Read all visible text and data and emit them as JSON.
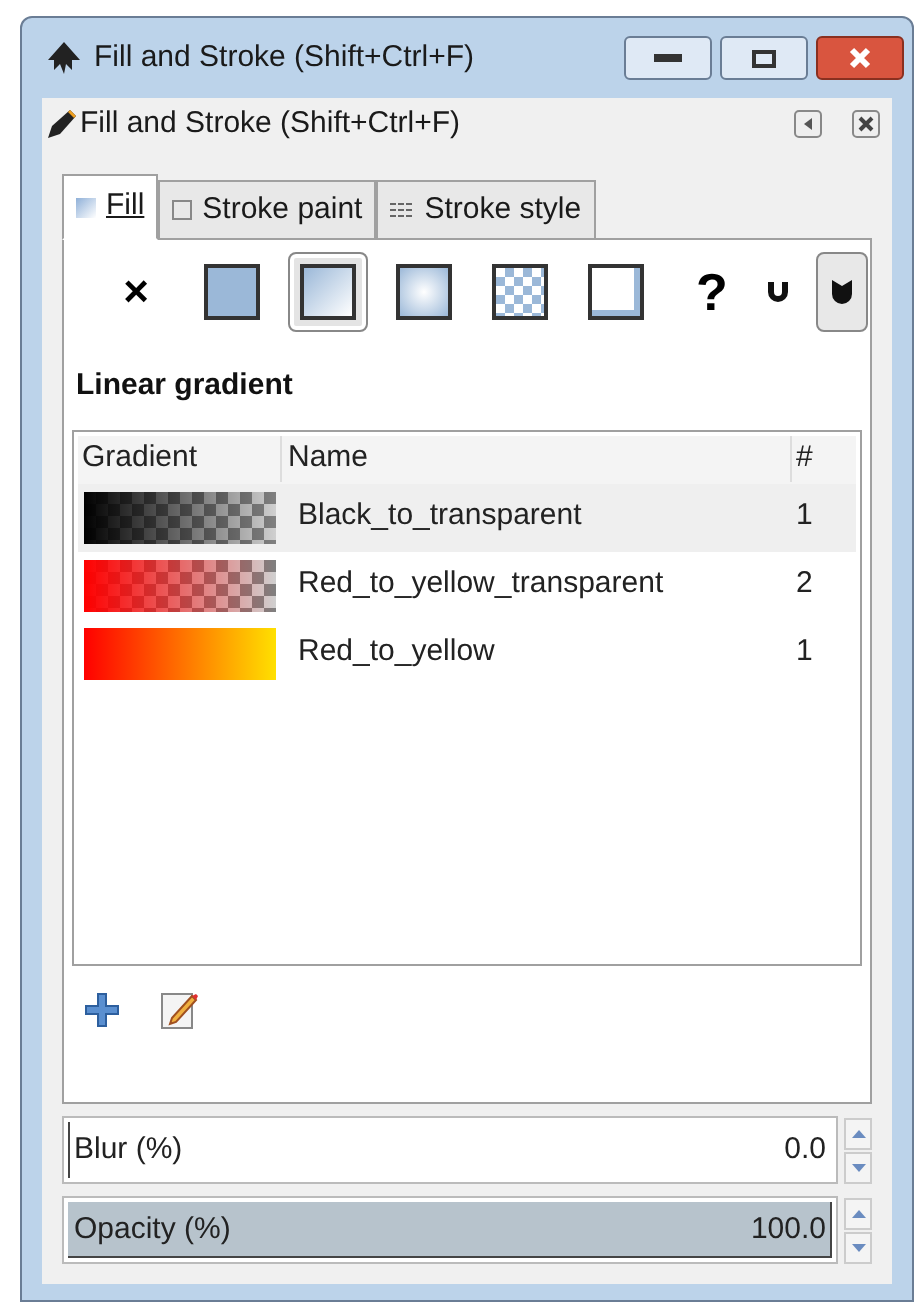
{
  "window": {
    "title": "Fill and Stroke (Shift+Ctrl+F)"
  },
  "dock": {
    "title": "Fill and Stroke (Shift+Ctrl+F)"
  },
  "tabs": [
    {
      "label": "Fill",
      "kind": "fill",
      "selected": true
    },
    {
      "label": "Stroke paint",
      "kind": "stroke",
      "selected": false
    },
    {
      "label": "Stroke style",
      "kind": "style",
      "selected": false
    }
  ],
  "paint_modes": [
    {
      "kind": "none",
      "symbol": "×",
      "selected": false
    },
    {
      "kind": "flat",
      "selected": false
    },
    {
      "kind": "linear",
      "selected": true
    },
    {
      "kind": "radial",
      "selected": false
    },
    {
      "kind": "pattern",
      "selected": false
    },
    {
      "kind": "swatch",
      "selected": false
    },
    {
      "kind": "unset",
      "symbol": "?",
      "selected": false
    }
  ],
  "fill_rules": [
    {
      "kind": "evenodd",
      "selected": false
    },
    {
      "kind": "nonzero",
      "selected": true
    }
  ],
  "section_title": "Linear gradient",
  "table": {
    "columns": [
      "Gradient",
      "Name",
      "#"
    ],
    "rows": [
      {
        "kind": "black_fade",
        "name": "Black_to_transparent",
        "count": "1",
        "selected": true
      },
      {
        "kind": "red_yellow_fade",
        "name": "Red_to_yellow_transparent",
        "count": "2",
        "selected": false
      },
      {
        "kind": "red_yellow",
        "name": "Red_to_yellow",
        "count": "1",
        "selected": false
      }
    ]
  },
  "spinners": [
    {
      "label": "Blur (%)",
      "value": "0.0",
      "level": 0
    },
    {
      "label": "Opacity (%)",
      "value": "100.0",
      "level": 1
    }
  ]
}
